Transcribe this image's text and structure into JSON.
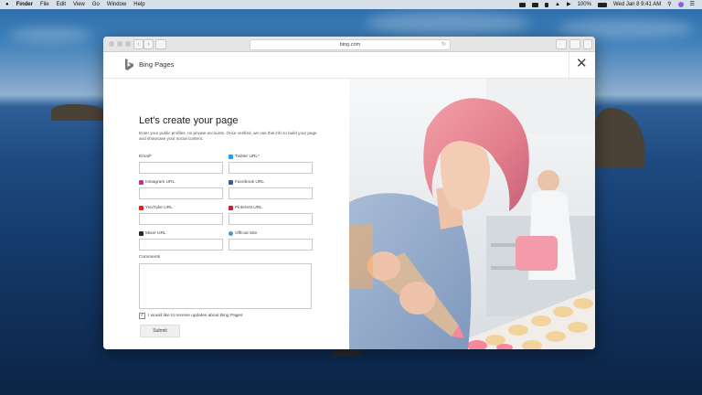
{
  "menubar": {
    "app": "Finder",
    "items": [
      "File",
      "Edit",
      "View",
      "Go",
      "Window",
      "Help"
    ],
    "battery": "100%",
    "clock": "Wed Jan 8  9:41 AM"
  },
  "browser": {
    "url": "bing.com"
  },
  "page": {
    "brand": "Bing Pages",
    "close_symbol": "✕",
    "title": "Let's create your page",
    "intro": "Enter your public profiles, no private accounts. Once verified, we use this info to build your page and showcase your social content.",
    "fields": {
      "email": "Email*",
      "twitter": "Twitter URL*",
      "instagram": "Instagram URL",
      "facebook": "Facebook URL",
      "youtube": "YouTube URL",
      "pinterest": "Pinterest URL",
      "mixer": "Mixer URL",
      "official": "Official Site"
    },
    "comments_label": "Comments",
    "updates_label": "I would like to receive updates about Bing Pages",
    "updates_checked": "✓",
    "submit_label": "Submit"
  },
  "colors": {
    "twitter": "#1da1f2",
    "instagram": "#c13584",
    "facebook": "#3b5998",
    "youtube": "#e62117",
    "pinterest": "#cb2027",
    "mixer": "#1e2a3c",
    "official": "#4a90d9"
  }
}
